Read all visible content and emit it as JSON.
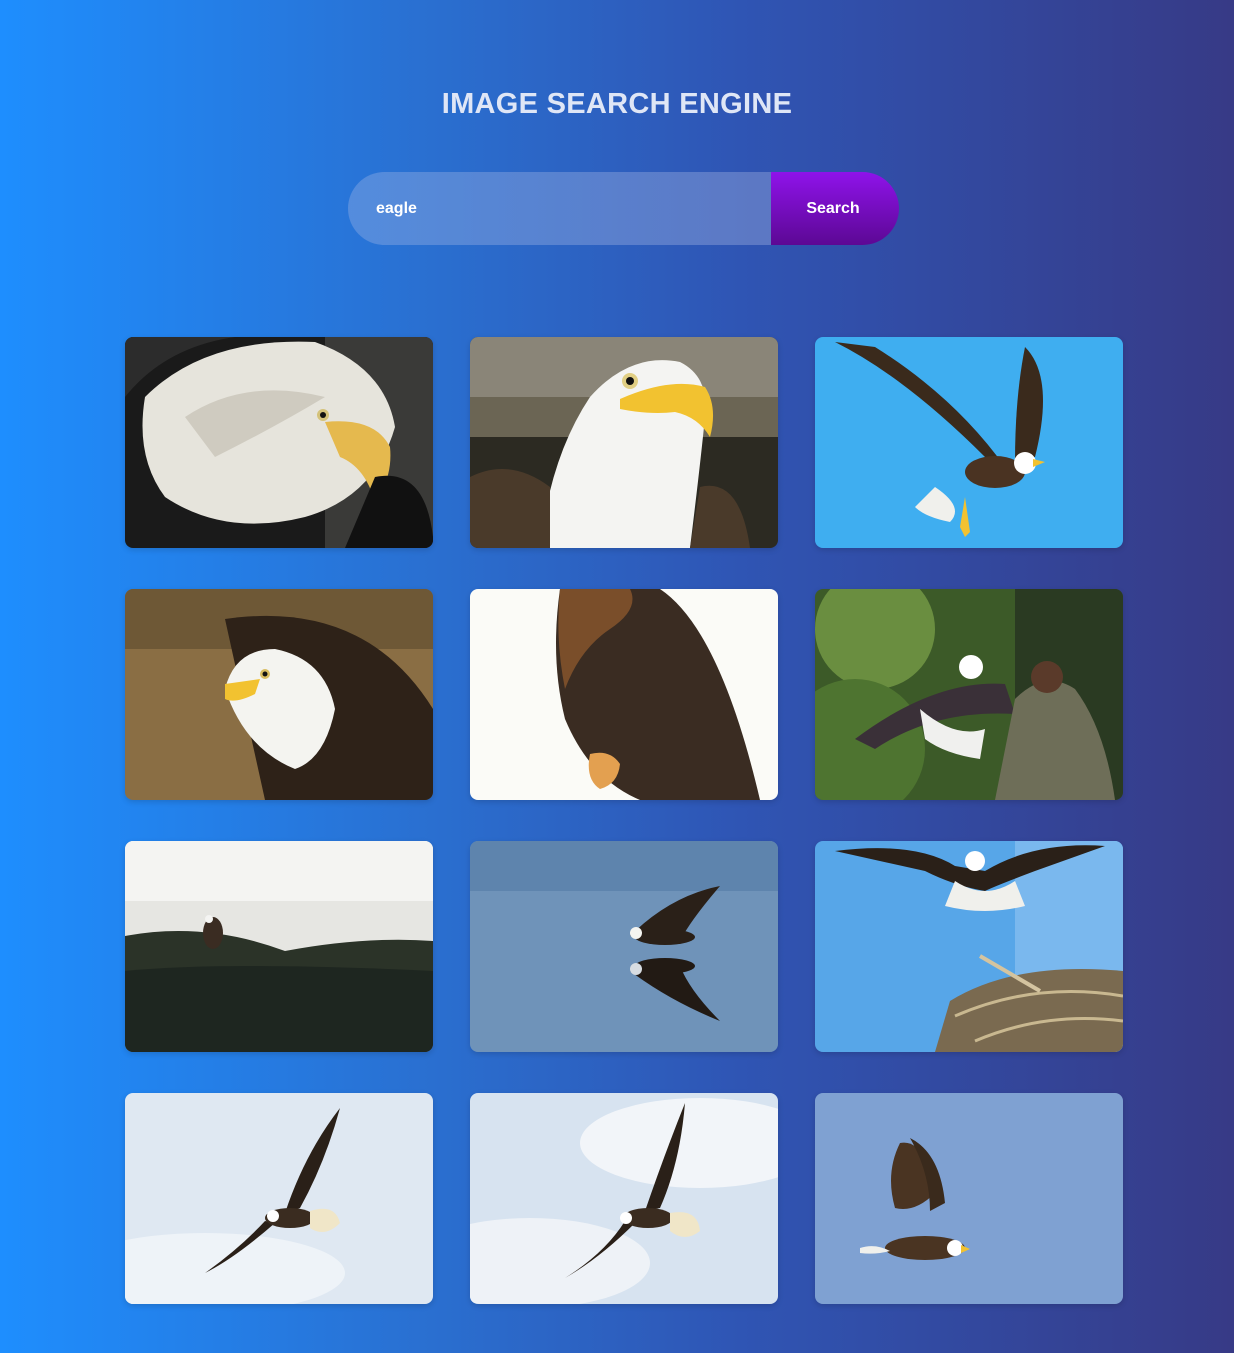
{
  "header": {
    "title": "IMAGE SEARCH ENGINE"
  },
  "search": {
    "query": "eagle",
    "button_label": "Search"
  },
  "results": [
    {
      "subject": "bald eagle head close-up, dark background"
    },
    {
      "subject": "bald eagle portrait, rocky background"
    },
    {
      "subject": "bald eagle in flight, blue sky"
    },
    {
      "subject": "bald eagle spreading wings, brown background"
    },
    {
      "subject": "eagle perched, white background illustration"
    },
    {
      "subject": "falconer with bald eagle, green trees"
    },
    {
      "subject": "eagle flying over misty forest"
    },
    {
      "subject": "eagle skimming water with reflection"
    },
    {
      "subject": "eagle landing on nest, blue sky"
    },
    {
      "subject": "eagle soaring, light cloudy sky"
    },
    {
      "subject": "eagle soaring, white clouds"
    },
    {
      "subject": "eagle gliding, pale blue sky"
    }
  ]
}
